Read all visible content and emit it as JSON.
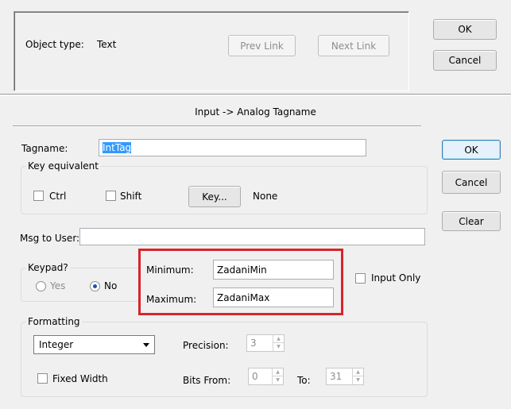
{
  "top": {
    "object_type_label": "Object type:",
    "object_type_value": "Text",
    "prev_link_label": "Prev Link",
    "next_link_label": "Next Link",
    "ok_label": "OK",
    "cancel_label": "Cancel"
  },
  "dialog": {
    "title": "Input -> Analog Tagname",
    "ok_label": "OK",
    "cancel_label": "Cancel",
    "clear_label": "Clear"
  },
  "tagname": {
    "label": "Tagname:",
    "value": "IntTag"
  },
  "key_equivalent": {
    "legend": "Key equivalent",
    "ctrl_label": "Ctrl",
    "shift_label": "Shift",
    "key_button_label": "Key...",
    "key_value": "None"
  },
  "msg_to_user": {
    "label": "Msg to User:",
    "value": ""
  },
  "keypad": {
    "legend": "Keypad?",
    "yes_label": "Yes",
    "no_label": "No",
    "selected": "No"
  },
  "limits": {
    "minimum_label": "Minimum:",
    "minimum_value": "ZadaniMin",
    "maximum_label": "Maximum:",
    "maximum_value": "ZadaniMax"
  },
  "input_only": {
    "label": "Input Only",
    "checked": false
  },
  "formatting": {
    "legend": "Formatting",
    "type_value": "Integer",
    "precision_label": "Precision:",
    "precision_value": "3",
    "fixed_width_label": "Fixed Width",
    "bits_from_label": "Bits From:",
    "bits_from_value": "0",
    "to_label": "To:",
    "to_value": "31"
  },
  "colors": {
    "highlight": "#d9242b",
    "selection": "#3399ff"
  }
}
